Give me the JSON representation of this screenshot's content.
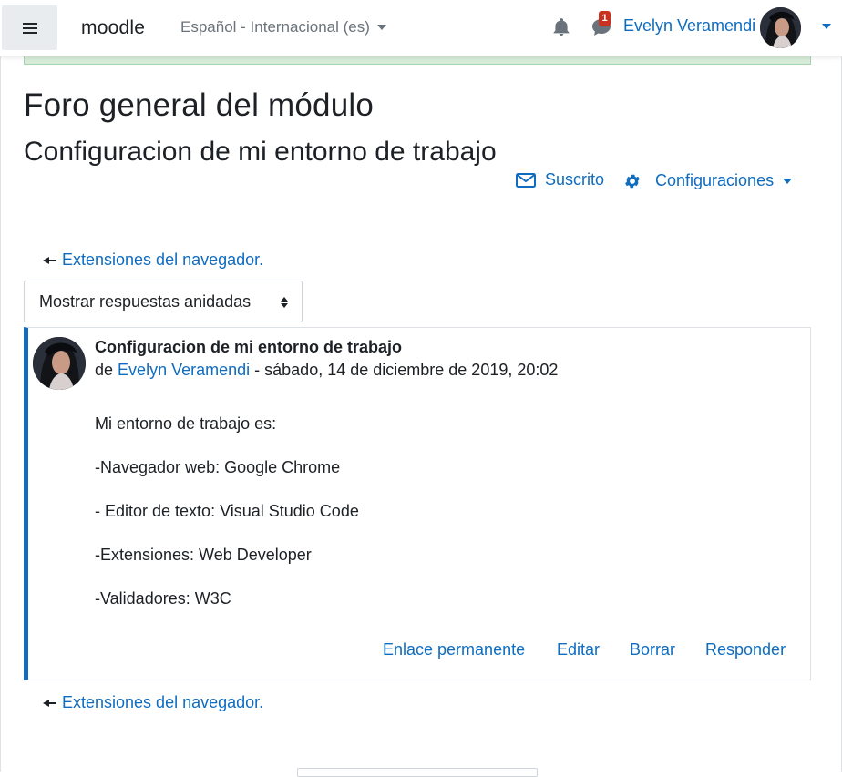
{
  "navbar": {
    "brand": "moodle",
    "language": "Español - Internacional (es)",
    "notifications_icon": "bell-icon",
    "messages_icon": "chat-bubble-icon",
    "messages_badge": "1",
    "user_name": "Evelyn Veramendi"
  },
  "page": {
    "title": "Foro general del módulo",
    "subtitle": "Configuracion de mi entorno de trabajo",
    "subscribed_label": "Suscrito",
    "settings_label": "Configuraciones"
  },
  "navigation": {
    "prev_link": "Extensiones del navegador.",
    "next_link": "Extensiones del navegador."
  },
  "display_mode": {
    "selected": "Mostrar respuestas anidadas"
  },
  "post": {
    "subject": "Configuracion de mi entorno de trabajo",
    "by_prefix": "de",
    "author": "Evelyn Veramendi",
    "date": "- sábado, 14 de diciembre de 2019, 20:02",
    "body": [
      "Mi entorno de trabajo es:",
      "-Navegador web: Google Chrome",
      "- Editor de texto: Visual Studio Code",
      "-Extensiones: Web Developer",
      "-Validadores: W3C"
    ],
    "actions": {
      "permalink": "Enlace permanente",
      "edit": "Editar",
      "delete": "Borrar",
      "reply": "Responder"
    }
  },
  "colors": {
    "link": "#0f6cbf",
    "accent_border": "#0f6cbf",
    "badge": "#ca3120",
    "success_strip": "#d7ecd8"
  }
}
